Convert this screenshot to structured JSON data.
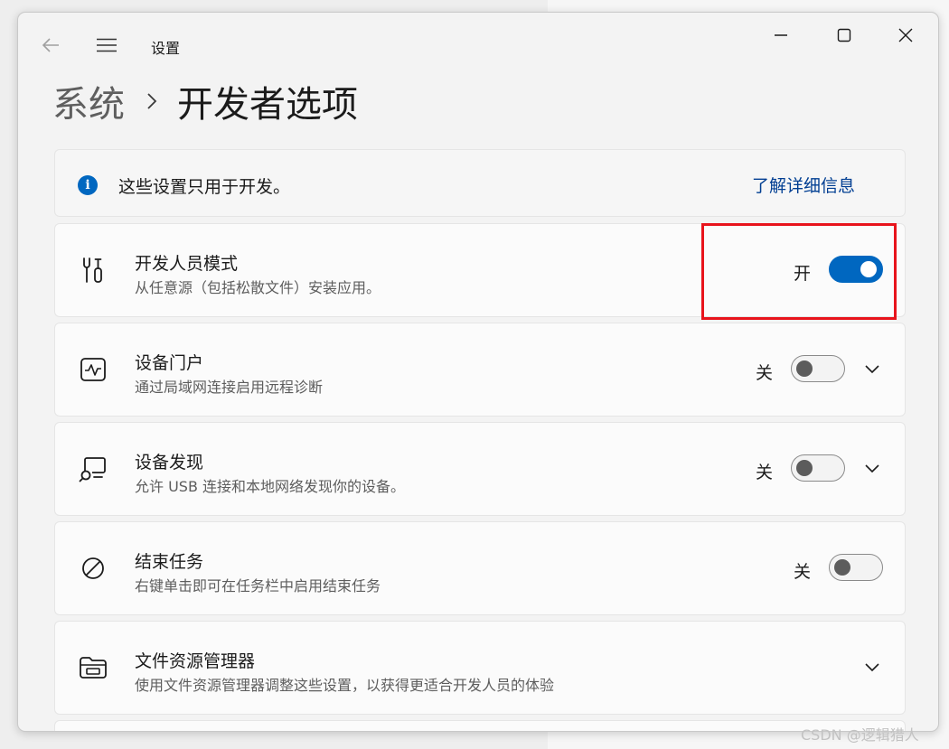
{
  "window": {
    "app_title": "设置",
    "buttons": {
      "back": "back-arrow-icon",
      "menu": "hamburger-icon",
      "minimize": "minimize-icon",
      "maximize": "maximize-icon",
      "close": "close-icon"
    }
  },
  "breadcrumb": {
    "parent": "系统",
    "separator": "chevron-right-icon",
    "current": "开发者选项"
  },
  "info_bar": {
    "icon": "info-icon",
    "text": "这些设置只用于开发。",
    "link": "了解详细信息"
  },
  "settings": [
    {
      "icon": "tools-icon",
      "title": "开发人员模式",
      "description": "从任意源（包括松散文件）安装应用。",
      "state_label": "开",
      "toggle_on": true,
      "expandable": false
    },
    {
      "icon": "device-portal-icon",
      "title": "设备门户",
      "description": "通过局域网连接启用远程诊断",
      "state_label": "关",
      "toggle_on": false,
      "expandable": true
    },
    {
      "icon": "device-discovery-icon",
      "title": "设备发现",
      "description": "允许 USB 连接和本地网络发现你的设备。",
      "state_label": "关",
      "toggle_on": false,
      "expandable": true
    },
    {
      "icon": "end-task-icon",
      "title": "结束任务",
      "description": "右键单击即可在任务栏中启用结束任务",
      "state_label": "关",
      "toggle_on": false,
      "expandable": false
    },
    {
      "icon": "file-explorer-icon",
      "title": "文件资源管理器",
      "description": "使用文件资源管理器调整这些设置，以获得更适合开发人员的体验",
      "expandable": true
    }
  ],
  "colors": {
    "accent": "#0067c0",
    "link": "#003e92",
    "highlight_box": "#e8141c"
  },
  "watermark": "CSDN @逻辑猎人"
}
